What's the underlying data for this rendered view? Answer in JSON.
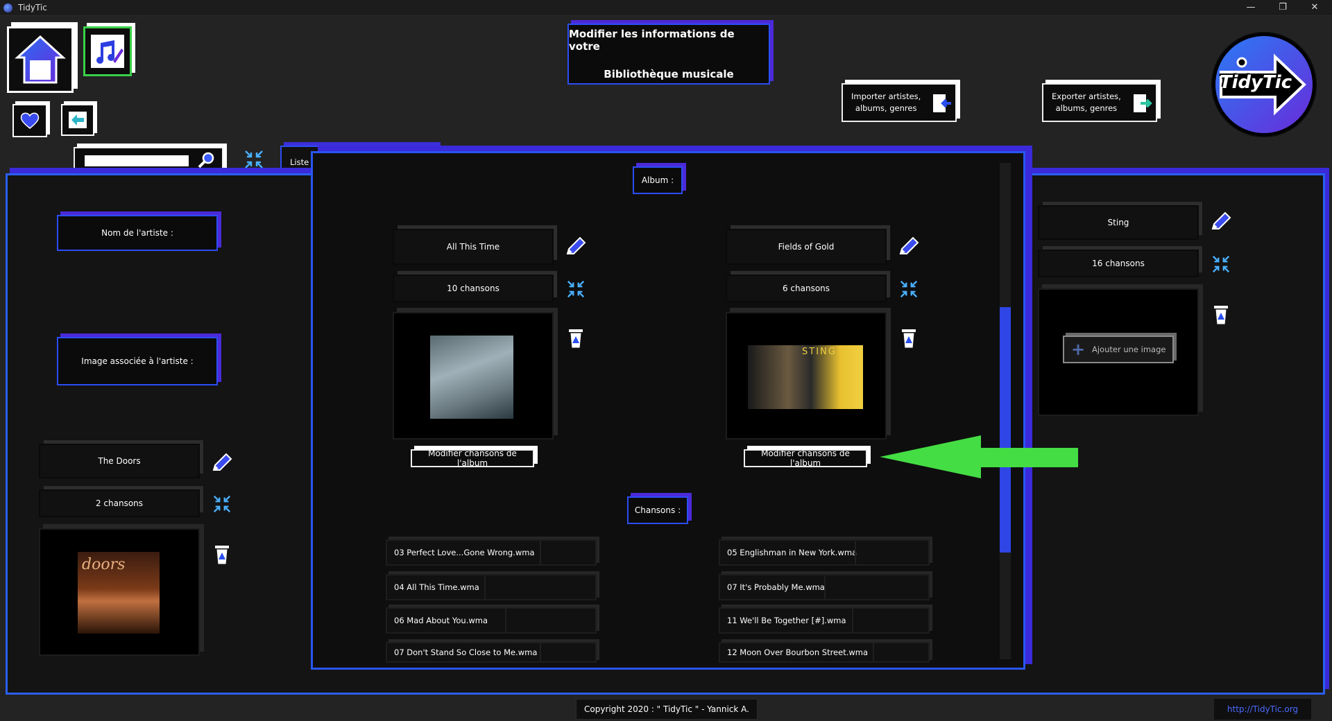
{
  "window": {
    "title": "TidyTic",
    "minimize": "—",
    "maximize": "❐",
    "close": "✕"
  },
  "header": {
    "title_line1": "Modifier les informations de votre",
    "title_line2": "Bibliothèque musicale",
    "import_line1": "Importer artistes,",
    "import_line2": "albums, genres",
    "export_line1": "Exporter artistes,",
    "export_line2": "albums, genres",
    "logo_text": "TidyTic"
  },
  "search": {
    "value": "",
    "placeholder": ""
  },
  "tab": {
    "label": "Liste"
  },
  "artist_panel": {
    "name_label": "Nom de l'artiste :",
    "image_label": "Image associée à l'artiste :",
    "artist_name": "The Doors",
    "song_count": "2 chansons",
    "cover_text": "doors"
  },
  "album_panel": {
    "album_label": "Album :",
    "songs_label": "Chansons :",
    "albums": [
      {
        "title": "All This Time",
        "count": "10 chansons",
        "button": "Modifier chansons de l'album"
      },
      {
        "title": "Fields of Gold",
        "count": "6 chansons",
        "button": "Modifier chansons de l'album",
        "cover_text": "STING"
      }
    ],
    "songs_left": [
      "03 Perfect Love...Gone Wrong.wma",
      "04 All This Time.wma",
      "06 Mad About You.wma",
      "07 Don't Stand So Close to Me.wma"
    ],
    "songs_right": [
      "05 Englishman in New York.wma",
      "07 It's Probably Me.wma",
      "11 We'll Be Together [#].wma",
      "12 Moon Over Bourbon Street.wma"
    ]
  },
  "right_panel": {
    "artist_name": "Sting",
    "song_count": "16 chansons",
    "add_image": "Ajouter une image"
  },
  "footer": {
    "copyright": "Copyright 2020 : \" TidyTic \" - Yannick A.",
    "link": "http://TidyTic.org"
  },
  "colors": {
    "accent_blue": "#2c4df5",
    "accent_purple": "#4b2ad9",
    "arrow_green": "#44dd44"
  }
}
